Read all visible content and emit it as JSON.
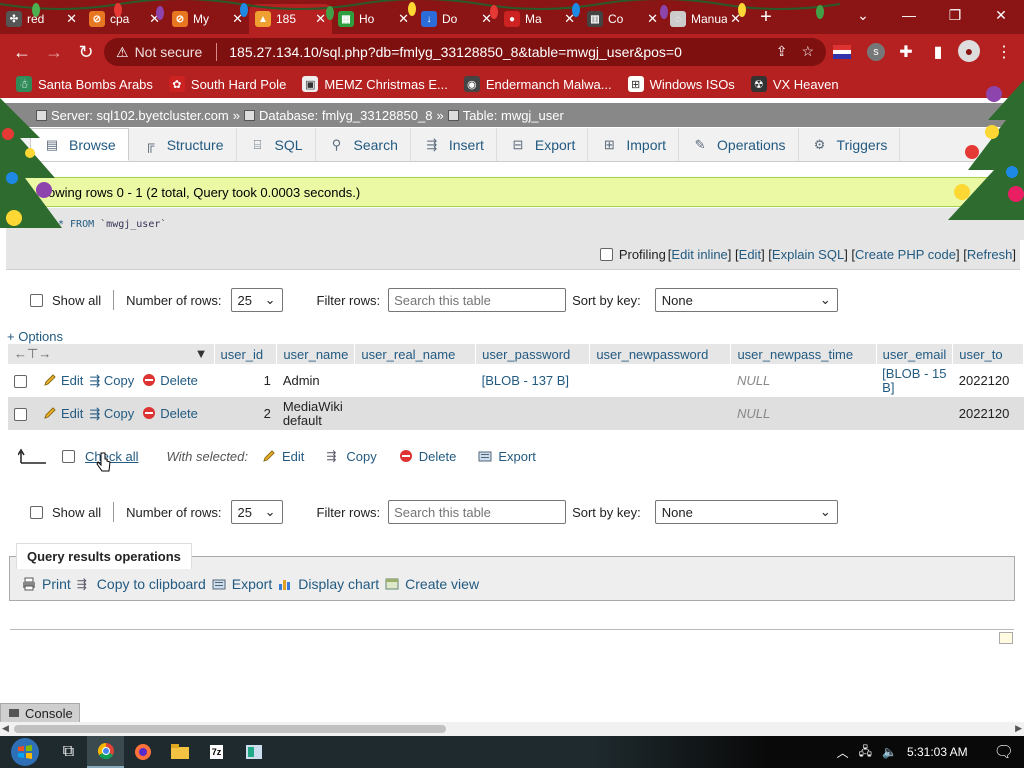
{
  "browser": {
    "tabs": [
      {
        "label": "red",
        "fav_color": "#555555",
        "fav_glyph": "✣"
      },
      {
        "label": "cpa",
        "fav_color": "#e87722",
        "fav_glyph": "⊘"
      },
      {
        "label": "My",
        "fav_color": "#e87722",
        "fav_glyph": "⊘"
      },
      {
        "label": "185",
        "fav_color": "#f0a030",
        "fav_glyph": "▲",
        "active": true
      },
      {
        "label": "Ho",
        "fav_color": "#2e9e3e",
        "fav_glyph": "▦"
      },
      {
        "label": "Do",
        "fav_color": "#2b6cd8",
        "fav_glyph": "↓"
      },
      {
        "label": "Ma",
        "fav_color": "#cc2222",
        "fav_glyph": "●"
      },
      {
        "label": "Co",
        "fav_color": "#444444",
        "fav_glyph": "▥"
      },
      {
        "label": "Manual",
        "fav_color": "#cccccc",
        "fav_glyph": "◌"
      }
    ],
    "new_tab": "+",
    "url": "185.27.134.10/sql.php?db=fmlyg_33128850_8&table=mwgj_user&pos=0",
    "security_label": "Not secure",
    "bookmarks": [
      {
        "label": "Santa Bombs Arabs",
        "color": "#2e8b57",
        "glyph": "☃"
      },
      {
        "label": "South Hard Pole",
        "color": "#cc2222",
        "glyph": "✿"
      },
      {
        "label": "MEMZ Christmas E...",
        "color": "#eeeeee",
        "glyph": "▣"
      },
      {
        "label": "Endermanch Malwa...",
        "color": "#444444",
        "glyph": "◉"
      },
      {
        "label": "Windows ISOs",
        "color": "#ffffff",
        "glyph": "⊞"
      },
      {
        "label": "VX Heaven",
        "color": "#333333",
        "glyph": "☢"
      }
    ]
  },
  "breadcrumb": {
    "server": "Server: sql102.byetcluster.com",
    "database": "Database: fmlyg_33128850_8",
    "table": "Table: mwgj_user"
  },
  "pma_tabs": [
    {
      "label": "Browse",
      "icon": "browse-icon",
      "glyph": "▤",
      "active": true
    },
    {
      "label": "Structure",
      "icon": "structure-icon",
      "glyph": "╔"
    },
    {
      "label": "SQL",
      "icon": "sql-icon",
      "glyph": "⌸"
    },
    {
      "label": "Search",
      "icon": "search-icon",
      "glyph": "⚲"
    },
    {
      "label": "Insert",
      "icon": "insert-icon",
      "glyph": "⇶"
    },
    {
      "label": "Export",
      "icon": "export-icon",
      "glyph": "⊟"
    },
    {
      "label": "Import",
      "icon": "import-icon",
      "glyph": "⊞"
    },
    {
      "label": "Operations",
      "icon": "wrench-icon",
      "glyph": "✎"
    },
    {
      "label": "Triggers",
      "icon": "triggers-icon",
      "glyph": "⚙"
    }
  ],
  "result": {
    "message": "owing rows 0 - 1 (2 total, Query took 0.0003 seconds.)",
    "sql_select": "* FROM",
    "sql_table": "`mwgj_user`"
  },
  "profiling": {
    "label": "Profiling",
    "links": [
      "Edit inline",
      "Edit",
      "Explain SQL",
      "Create PHP code",
      "Refresh"
    ]
  },
  "nav": {
    "show_all": "Show all",
    "rows_label": "Number of rows:",
    "rows_value": "25",
    "filter_label": "Filter rows:",
    "filter_placeholder": "Search this table",
    "sort_label": "Sort by key:",
    "sort_value": "None"
  },
  "options_label": "+ Options",
  "table": {
    "columns": [
      "user_id",
      "user_name",
      "user_real_name",
      "user_password",
      "user_newpassword",
      "user_newpass_time",
      "user_email",
      "user_to"
    ],
    "rows": [
      {
        "user_id": "1",
        "user_name": "Admin",
        "user_real_name": "",
        "user_password": "[BLOB - 137 B]",
        "user_newpassword": "",
        "user_newpass_time": "NULL",
        "user_email": "[BLOB - 15 B]",
        "user_to": "2022120"
      },
      {
        "user_id": "2",
        "user_name": "MediaWiki default",
        "user_real_name": "",
        "user_password": "",
        "user_newpassword": "",
        "user_newpass_time": "NULL",
        "user_email": "",
        "user_to": "2022120"
      }
    ],
    "row_actions": {
      "edit": "Edit",
      "copy": "Copy",
      "delete": "Delete"
    }
  },
  "with_selected": {
    "check_all": "Check all",
    "label": "With selected:",
    "edit": "Edit",
    "copy": "Copy",
    "delete": "Delete",
    "export": "Export"
  },
  "query_ops": {
    "title": "Query results operations",
    "print": "Print",
    "copy": "Copy to clipboard",
    "export": "Export",
    "chart": "Display chart",
    "view": "Create view"
  },
  "console_label": "Console",
  "taskbar": {
    "time": "5:31:03 AM"
  },
  "colors": {
    "browser_dark": "#8b1414",
    "browser_red": "#b52020",
    "link": "#235a81",
    "success_bg": "#ebf8a4"
  }
}
